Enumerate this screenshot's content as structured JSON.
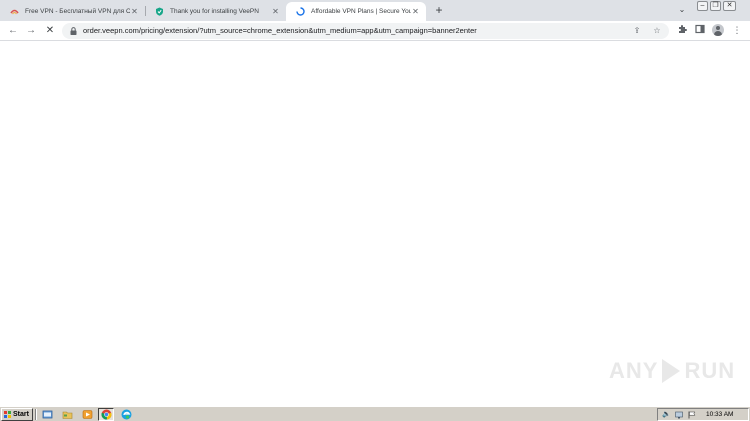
{
  "browser": {
    "tabs": [
      {
        "title": "Free VPN - Бесплатный VPN для Chrome",
        "active": false
      },
      {
        "title": "Thank you for installing VeePN",
        "active": false
      },
      {
        "title": "Affordable VPN Plans | Secure Your Internet",
        "active": true
      }
    ],
    "new_tab_label": "+",
    "url": "order.veepn.com/pricing/extension/?utm_source=chrome_extension&utm_medium=app&utm_campaign=banner2enter"
  },
  "watermark": {
    "text_left": "ANY",
    "text_right": "RUN"
  },
  "taskbar": {
    "start_label": "Start",
    "clock": "10:33 AM"
  },
  "colors": {
    "tabstrip_bg": "#dee1e6",
    "omnibox_bg": "#f1f3f4",
    "taskbar_bg": "#d4d0c8",
    "chrome_blue": "#1a73e8"
  },
  "icons": {
    "tab1": "veepn-fan-icon",
    "tab2": "veepn-shield-icon",
    "tab3": "loading-spinner-icon",
    "taskbar": [
      "ie-icon",
      "folder-icon",
      "media-player-icon",
      "chrome-icon",
      "edge-icon"
    ],
    "tray": [
      "volume-icon",
      "network-icon",
      "flag-icon"
    ]
  }
}
